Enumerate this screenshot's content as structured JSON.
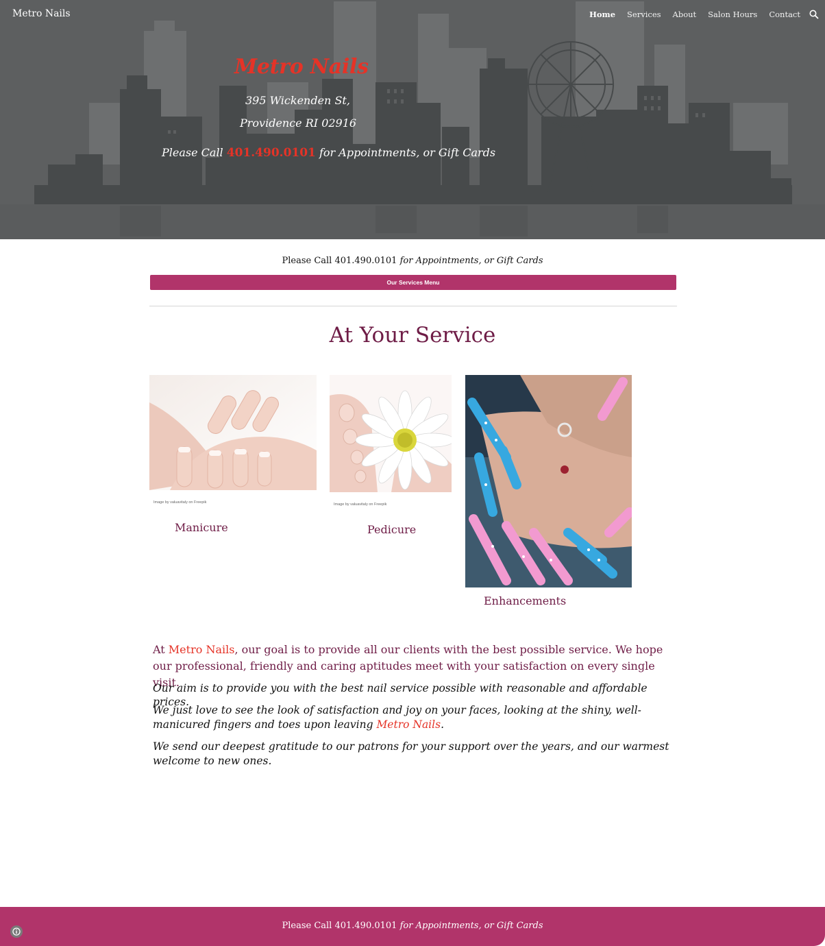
{
  "header": {
    "site_title": "Metro Nails",
    "nav": [
      "Home",
      "Services",
      "About",
      "Salon Hours",
      "Contact"
    ],
    "active_nav": "Home",
    "search_icon": "search-icon"
  },
  "hero": {
    "title": "Metro Nails",
    "address_line1": "395 Wickenden St,",
    "address_line2": "Providence RI 02916",
    "call_prefix": "Please Call ",
    "phone": "401.490.0101",
    "call_suffix": " for Appointments, or Gift Cards"
  },
  "main": {
    "call_line_prefix": "Please Call 401.490.0101 ",
    "call_line_suffix": "for Appointments, or Gift Cards",
    "services_button": "Our Services Menu",
    "section_title": "At Your Service",
    "services": [
      {
        "label": "Manicure",
        "credit": "Image by valuavitaly on Freepik"
      },
      {
        "label": "Pedicure",
        "credit": "Image by valuavitaly on Freepik"
      },
      {
        "label": "Enhancements"
      }
    ],
    "para1_prefix": "At ",
    "para1_brand": "Metro Nails",
    "para1_suffix": ", our goal is to provide all our clients with the best possible service. We hope our professional, friendly and caring aptitudes meet with your satisfaction on every single visit.",
    "para2": "Our aim is to provide you with the best nail service possible with reasonable and affordable prices.",
    "para3_prefix": "We just love to see the look of satisfaction and joy on your faces, looking at the shiny, well-manicured fingers and toes upon leaving ",
    "para3_brand": "Metro Nails",
    "para3_suffix": ".",
    "para4": "We send our deepest gratitude to our patrons for your support over the years, and our warmest welcome to new ones."
  },
  "footer": {
    "text_prefix": "Please Call 401.490.0101 ",
    "text_suffix": "for Appointments, or Gift Cards",
    "info_icon": "info-icon"
  },
  "colors": {
    "brand_red": "#e53327",
    "accent_magenta": "#b1346a",
    "heading_plum": "#6e1c46",
    "hero_bg": "#5d5f60"
  }
}
